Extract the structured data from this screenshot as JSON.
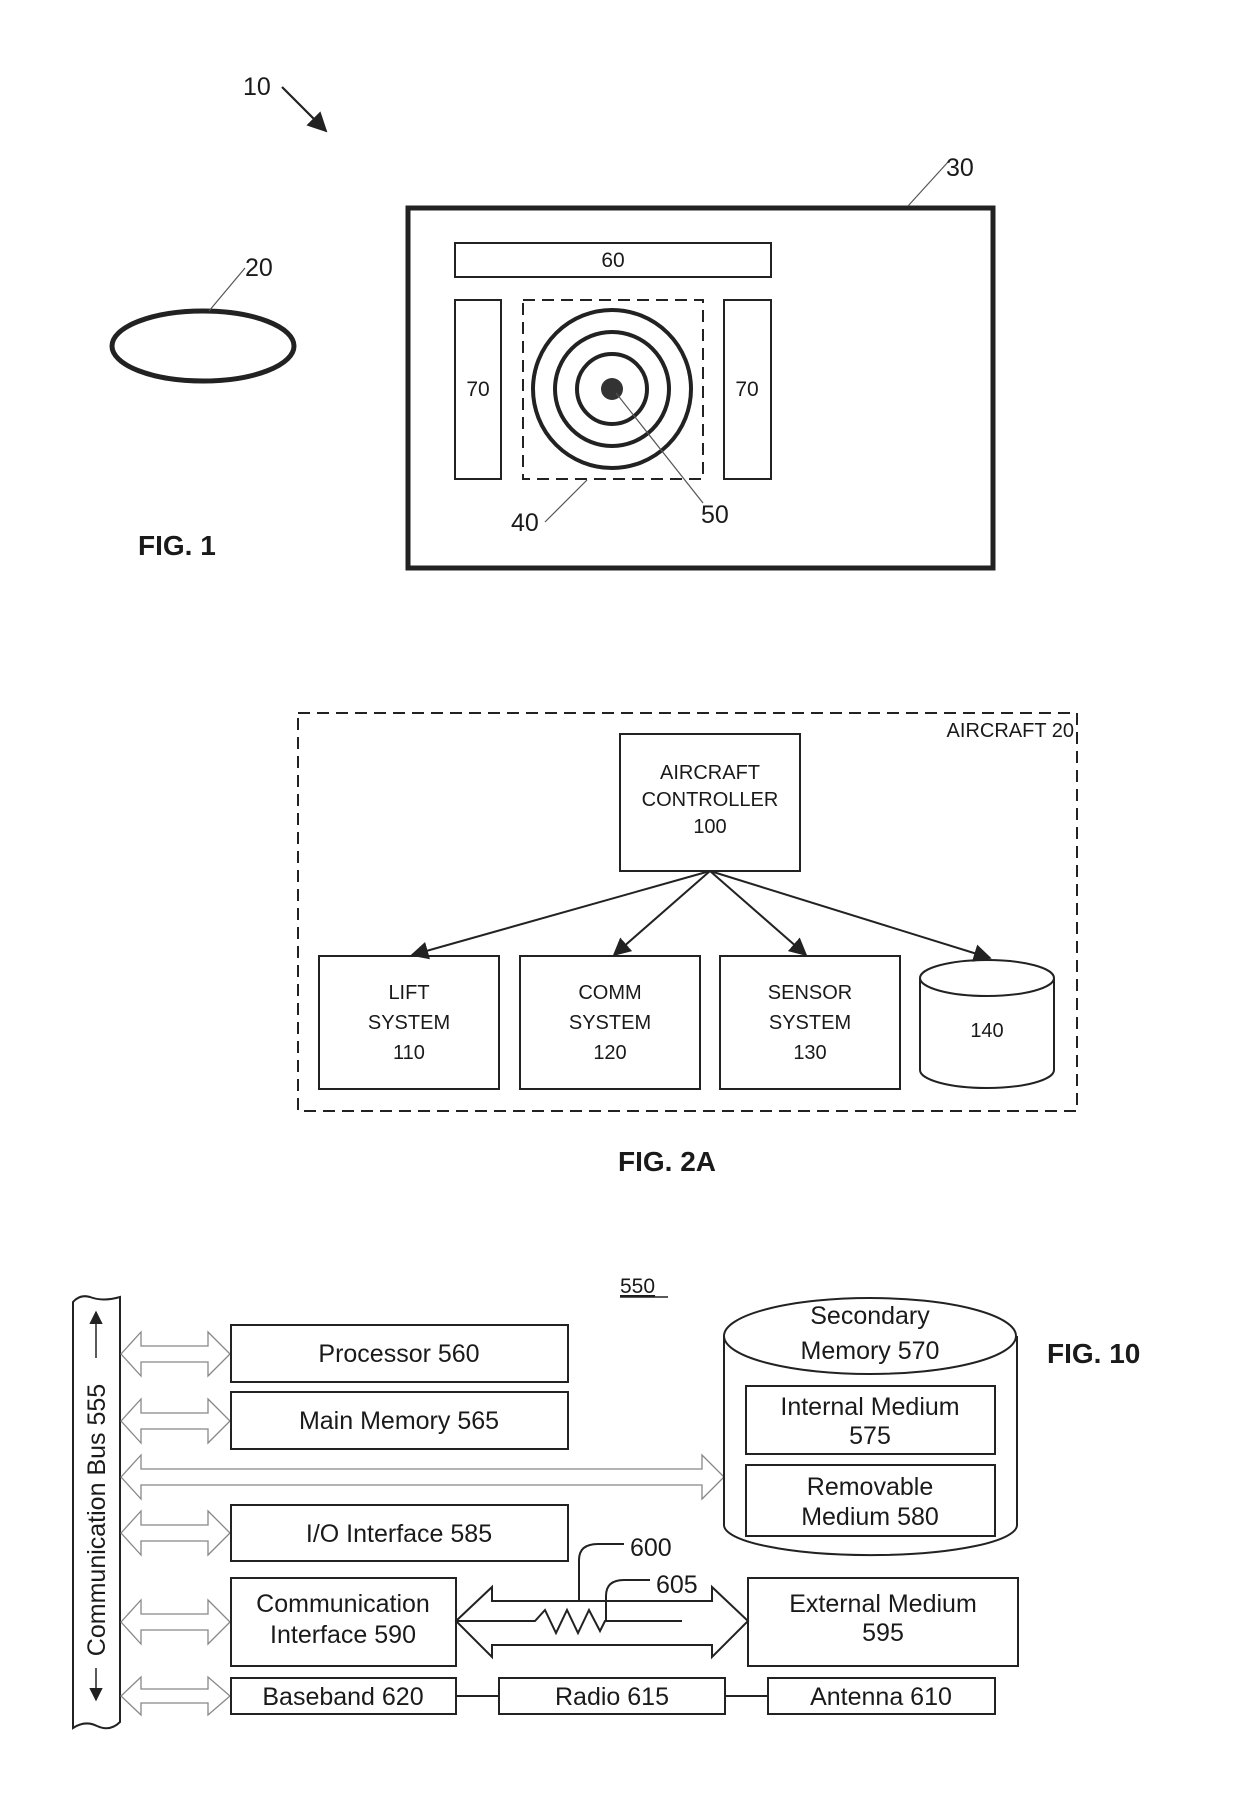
{
  "fig1": {
    "caption": "FIG. 1",
    "system_ref": "10",
    "aircraft_ref": "20",
    "display_ref": "30",
    "zone_ref": "40",
    "target_ref": "50",
    "top_panel_label": "60",
    "left_panel_label": "70",
    "right_panel_label": "70"
  },
  "fig2a": {
    "caption": "FIG. 2A",
    "container_label": "AIRCRAFT 20",
    "controller": [
      "AIRCRAFT",
      "CONTROLLER",
      "100"
    ],
    "subsystems": [
      {
        "lines": [
          "LIFT",
          "SYSTEM",
          "110"
        ]
      },
      {
        "lines": [
          "COMM",
          "SYSTEM",
          "120"
        ]
      },
      {
        "lines": [
          "SENSOR",
          "SYSTEM",
          "130"
        ]
      }
    ],
    "storage_label": "140"
  },
  "fig10": {
    "caption": "FIG. 10",
    "system_ref": "550",
    "bus_label": "Communication Bus 555",
    "processor": "Processor 560",
    "main_memory": "Main Memory 565",
    "secondary_memory": [
      "Secondary",
      "Memory 570"
    ],
    "internal_medium": [
      "Internal Medium",
      "575"
    ],
    "removable_medium": [
      "Removable",
      "Medium 580"
    ],
    "io_interface": "I/O Interface 585",
    "comm_interface": [
      "Communication",
      "Interface 590"
    ],
    "external_medium": [
      "External Medium",
      "595"
    ],
    "channel_ref": "600",
    "signal_ref": "605",
    "baseband": "Baseband 620",
    "radio": "Radio 615",
    "antenna": "Antenna 610"
  }
}
